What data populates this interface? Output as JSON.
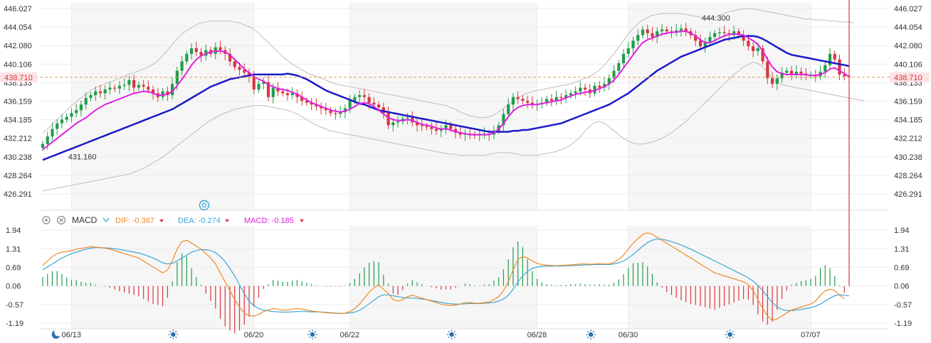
{
  "colors": {
    "up": "#1f9e4a",
    "down": "#d9363e",
    "ma_slow": "#1a1ac8",
    "ma_fast": "#e020e0",
    "band": "#c8b8bc",
    "current_line": "#e0a060",
    "current_tag_bg": "#fbe3e5",
    "current_tag_text": "#d9363e",
    "dif": "#f08a24",
    "dea": "#3aa6d8",
    "macd": "#e020e0",
    "grid": "#ececec"
  },
  "macd_toolbar": {
    "label": "MACD",
    "dif_label": "DIF: -0.367",
    "dea_label": "DEA: -0.274",
    "macd_label": "MACD: -0.185"
  },
  "chart_data": [
    {
      "type": "candlestick",
      "y_ticks": [
        "446.027",
        "444.054",
        "442.080",
        "440.106",
        "438.133",
        "436.159",
        "434.185",
        "432.212",
        "430.238",
        "428.264",
        "426.291"
      ],
      "ylim": [
        426.291,
        446.027
      ],
      "current_price": "438.710",
      "annotations": [
        {
          "text": "444.300",
          "x_index": 137,
          "value": 444.3
        },
        {
          "text": "431.160",
          "x_index": 5,
          "value": 431.16
        }
      ],
      "x_ticks": [
        {
          "label": "06/13",
          "index": 6
        },
        {
          "label": "06/20",
          "index": 44
        },
        {
          "label": "06/22",
          "index": 64
        },
        {
          "label": "06/28",
          "index": 103
        },
        {
          "label": "06/30",
          "index": 122
        },
        {
          "label": "07/07",
          "index": 160
        }
      ],
      "night_markers": [
        1
      ],
      "day_markers": [
        26,
        55,
        84,
        113,
        142
      ],
      "closes": [
        431.6,
        432.4,
        433.2,
        433.8,
        434.2,
        434.5,
        434.9,
        435.2,
        435.8,
        436.5,
        436.8,
        437.2,
        437.0,
        437.4,
        437.6,
        437.5,
        437.8,
        437.9,
        438.4,
        437.6,
        437.9,
        437.7,
        437.4,
        437.0,
        436.6,
        437.2,
        436.8,
        438.0,
        439.4,
        440.4,
        441.2,
        441.8,
        441.4,
        441.0,
        441.6,
        441.2,
        441.9,
        441.6,
        441.2,
        440.4,
        439.8,
        439.5,
        439.2,
        438.8,
        437.4,
        438.0,
        438.2,
        436.6,
        437.6,
        437.2,
        437.0,
        436.8,
        437.0,
        436.6,
        436.2,
        436.0,
        435.8,
        435.6,
        435.4,
        435.2,
        434.9,
        434.8,
        435.0,
        435.4,
        436.2,
        436.6,
        436.8,
        436.6,
        436.0,
        435.8,
        435.5,
        434.9,
        433.6,
        433.9,
        434.0,
        434.3,
        434.4,
        433.9,
        433.6,
        433.5,
        433.4,
        433.2,
        433.0,
        433.2,
        433.6,
        433.2,
        432.8,
        432.6,
        432.7,
        432.6,
        432.5,
        432.6,
        432.7,
        432.6,
        433.0,
        433.6,
        434.8,
        435.8,
        436.6,
        436.4,
        436.2,
        436.0,
        435.8,
        435.9,
        436.0,
        436.4,
        436.2,
        436.6,
        436.5,
        436.8,
        437.0,
        437.2,
        437.6,
        437.4,
        437.0,
        437.8,
        437.6,
        438.0,
        438.6,
        439.4,
        440.2,
        441.2,
        441.8,
        442.6,
        443.2,
        443.8,
        443.4,
        443.0,
        443.6,
        443.8,
        443.6,
        443.5,
        443.7,
        443.9,
        443.6,
        443.2,
        442.6,
        442.0,
        442.5,
        443.0,
        443.4,
        443.5,
        443.4,
        443.2,
        443.6,
        443.2,
        442.6,
        442.0,
        441.5,
        441.8,
        440.4,
        438.6,
        438.0,
        438.6,
        439.2,
        439.4,
        439.0,
        439.3,
        439.1,
        438.9,
        439.0,
        438.8,
        439.3,
        440.0,
        441.2,
        440.6,
        439.0,
        438.8,
        438.7
      ],
      "ma_fast": [
        431.0,
        431.4,
        431.8,
        432.2,
        432.6,
        433.0,
        433.4,
        433.8,
        434.1,
        434.4,
        434.8,
        435.2,
        435.5,
        435.8,
        436.0,
        436.2,
        436.4,
        436.6,
        436.8,
        437.0,
        437.1,
        437.2,
        437.2,
        437.0,
        436.8,
        436.8,
        436.9,
        437.2,
        437.8,
        438.5,
        439.2,
        440.0,
        440.6,
        441.0,
        441.2,
        441.4,
        441.5,
        441.5,
        441.4,
        441.1,
        440.6,
        440.1,
        439.6,
        439.2,
        438.8,
        438.5,
        438.3,
        437.9,
        437.7,
        437.5,
        437.4,
        437.3,
        437.1,
        436.9,
        436.6,
        436.3,
        436.0,
        435.8,
        435.6,
        435.4,
        435.2,
        435.1,
        435.0,
        435.1,
        435.3,
        435.6,
        435.9,
        436.0,
        435.9,
        435.6,
        435.2,
        434.8,
        434.4,
        434.2,
        434.1,
        434.1,
        434.2,
        434.1,
        433.9,
        433.7,
        433.6,
        433.5,
        433.3,
        433.2,
        433.2,
        433.1,
        432.9,
        432.8,
        432.7,
        432.6,
        432.6,
        432.6,
        432.6,
        432.6,
        432.8,
        433.2,
        433.8,
        434.5,
        435.1,
        435.5,
        435.7,
        435.8,
        435.8,
        435.8,
        435.9,
        436.0,
        436.1,
        436.2,
        436.3,
        436.5,
        436.7,
        436.9,
        437.0,
        437.1,
        437.2,
        437.3,
        437.5,
        437.7,
        438.0,
        438.4,
        439.0,
        439.7,
        440.4,
        441.1,
        441.8,
        442.4,
        442.7,
        442.9,
        443.1,
        443.3,
        443.4,
        443.5,
        443.5,
        443.6,
        443.6,
        443.4,
        443.1,
        442.7,
        442.4,
        442.4,
        442.6,
        442.9,
        443.1,
        443.3,
        443.3,
        443.3,
        443.2,
        442.9,
        442.6,
        442.2,
        441.5,
        440.6,
        439.8,
        439.3,
        439.1,
        439.0,
        439.0,
        439.0,
        439.0,
        439.0,
        438.9,
        438.9,
        439.0,
        439.2,
        439.6,
        439.7,
        439.4,
        439.1,
        438.8
      ],
      "ma_slow": [
        429.9,
        430.1,
        430.3,
        430.5,
        430.7,
        430.9,
        431.1,
        431.3,
        431.5,
        431.7,
        431.9,
        432.1,
        432.3,
        432.5,
        432.7,
        432.9,
        433.1,
        433.3,
        433.5,
        433.7,
        433.9,
        434.1,
        434.3,
        434.5,
        434.7,
        434.9,
        435.1,
        435.3,
        435.6,
        435.9,
        436.2,
        436.5,
        436.8,
        437.1,
        437.4,
        437.7,
        437.9,
        438.1,
        438.3,
        438.5,
        438.6,
        438.7,
        438.8,
        438.9,
        439.0,
        439.0,
        439.0,
        439.0,
        439.0,
        439.0,
        439.0,
        439.1,
        439.0,
        438.9,
        438.7,
        438.5,
        438.2,
        437.9,
        437.6,
        437.3,
        437.1,
        436.9,
        436.7,
        436.5,
        436.3,
        436.1,
        435.9,
        435.8,
        435.6,
        435.4,
        435.2,
        435.1,
        435.0,
        434.9,
        434.8,
        434.7,
        434.6,
        434.5,
        434.4,
        434.3,
        434.2,
        434.1,
        434.0,
        433.9,
        433.8,
        433.7,
        433.6,
        433.5,
        433.4,
        433.3,
        433.2,
        433.1,
        433.0,
        432.9,
        432.9,
        432.9,
        432.9,
        432.9,
        433.0,
        433.0,
        433.1,
        433.1,
        433.2,
        433.3,
        433.4,
        433.5,
        433.6,
        433.7,
        433.8,
        434.0,
        434.2,
        434.4,
        434.6,
        434.8,
        435.0,
        435.2,
        435.4,
        435.6,
        435.8,
        436.1,
        436.4,
        436.7,
        437.0,
        437.4,
        437.8,
        438.2,
        438.6,
        439.0,
        439.4,
        439.7,
        440.0,
        440.3,
        440.6,
        440.9,
        441.1,
        441.3,
        441.5,
        441.7,
        441.9,
        442.1,
        442.3,
        442.5,
        442.7,
        442.8,
        442.9,
        443.0,
        443.1,
        443.1,
        443.1,
        443.0,
        442.8,
        442.5,
        442.2,
        441.9,
        441.6,
        441.3,
        441.1,
        441.0,
        440.9,
        440.8,
        440.7,
        440.6,
        440.5,
        440.4,
        440.3,
        440.2,
        440.1,
        440.0,
        439.9
      ],
      "band_upper": [
        432.8,
        433.2,
        433.7,
        434.2,
        434.7,
        435.2,
        435.7,
        436.1,
        436.5,
        436.9,
        437.3,
        437.6,
        437.8,
        438.0,
        438.2,
        438.4,
        438.6,
        438.8,
        439.0,
        439.2,
        439.4,
        439.6,
        439.8,
        440.1,
        440.5,
        441.0,
        441.6,
        442.2,
        442.8,
        443.3,
        443.7,
        444.0,
        444.3,
        444.5,
        444.6,
        444.7,
        444.7,
        444.7,
        444.7,
        444.7,
        444.6,
        444.5,
        444.3,
        444.1,
        443.8,
        443.4,
        442.9,
        442.4,
        441.9,
        441.4,
        440.9,
        440.5,
        440.1,
        439.8,
        439.5,
        439.2,
        439.0,
        438.8,
        438.6,
        438.4,
        438.2,
        438.0,
        437.9,
        437.8,
        437.7,
        437.6,
        437.5,
        437.4,
        437.3,
        437.2,
        437.1,
        437.0,
        436.9,
        436.8,
        436.7,
        436.6,
        436.5,
        436.4,
        436.3,
        436.2,
        436.1,
        436.0,
        435.9,
        435.8,
        435.7,
        435.5,
        435.3,
        435.0,
        434.8,
        434.6,
        434.5,
        434.4,
        434.4,
        434.5,
        434.7,
        435.0,
        435.4,
        435.8,
        436.2,
        436.5,
        436.8,
        437.0,
        437.2,
        437.3,
        437.4,
        437.5,
        437.6,
        437.7,
        437.8,
        437.9,
        438.0,
        438.2,
        438.4,
        438.6,
        438.8,
        439.1,
        439.5,
        440.0,
        440.6,
        441.2,
        441.9,
        442.6,
        443.3,
        443.9,
        444.4,
        444.8,
        445.1,
        445.3,
        445.4,
        445.5,
        445.5,
        445.5,
        445.5,
        445.5,
        445.4,
        445.3,
        445.2,
        445.1,
        445.0,
        445.0,
        445.1,
        445.3,
        445.5,
        445.7,
        445.8,
        445.9,
        446.0,
        446.0,
        446.0,
        445.9,
        445.8,
        445.7,
        445.6,
        445.5,
        445.4,
        445.3,
        445.2,
        445.1,
        445.0,
        444.9,
        444.9,
        444.8,
        444.8,
        444.8,
        444.7,
        444.7,
        444.6,
        444.6,
        444.6,
        444.5
      ],
      "band_lower": [
        426.6,
        426.7,
        426.8,
        426.9,
        427.0,
        427.1,
        427.2,
        427.3,
        427.4,
        427.5,
        427.6,
        427.7,
        427.8,
        427.9,
        428.0,
        428.1,
        428.2,
        428.3,
        428.4,
        428.6,
        428.8,
        429.0,
        429.3,
        429.6,
        429.9,
        430.2,
        430.6,
        431.0,
        431.4,
        431.8,
        432.2,
        432.6,
        433.0,
        433.4,
        433.8,
        434.1,
        434.4,
        434.7,
        434.9,
        435.1,
        435.3,
        435.4,
        435.5,
        435.6,
        435.7,
        435.7,
        435.7,
        435.6,
        435.5,
        435.4,
        435.3,
        435.2,
        435.0,
        434.8,
        434.5,
        434.2,
        433.9,
        433.6,
        433.4,
        433.2,
        433.0,
        432.9,
        432.8,
        432.7,
        432.6,
        432.5,
        432.4,
        432.3,
        432.2,
        432.1,
        432.0,
        431.9,
        431.8,
        431.7,
        431.6,
        431.5,
        431.4,
        431.3,
        431.2,
        431.1,
        431.0,
        430.9,
        430.8,
        430.7,
        430.6,
        430.5,
        430.5,
        430.4,
        430.4,
        430.4,
        430.4,
        430.4,
        430.4,
        430.5,
        430.6,
        430.7,
        430.7,
        430.7,
        430.6,
        430.5,
        430.4,
        430.4,
        430.4,
        430.4,
        430.5,
        430.6,
        430.7,
        430.8,
        431.0,
        431.2,
        431.5,
        431.9,
        432.4,
        433.0,
        433.5,
        433.9,
        434.0,
        433.8,
        433.4,
        433.0,
        432.6,
        432.2,
        431.9,
        431.7,
        431.6,
        431.6,
        431.7,
        431.8,
        432.0,
        432.2,
        432.5,
        432.8,
        433.2,
        433.6,
        434.0,
        434.5,
        435.0,
        435.5,
        436.0,
        436.5,
        437.0,
        437.5,
        438.0,
        438.5,
        439.0,
        439.4,
        439.8,
        440.1,
        440.3,
        440.2,
        439.8,
        439.2,
        438.6,
        438.2,
        437.9,
        437.8,
        437.7,
        437.6,
        437.5,
        437.4,
        437.3,
        437.2,
        437.1,
        437.0,
        436.9,
        436.8,
        436.7,
        436.6,
        436.5,
        436.4,
        436.3,
        436.2
      ]
    },
    {
      "type": "macd",
      "y_ticks": [
        "1.94",
        "1.31",
        "0.69",
        "0.06",
        "-0.57",
        "-1.19"
      ],
      "ylim": [
        -1.19,
        1.94
      ],
      "dif": [
        0.75,
        0.9,
        1.05,
        1.15,
        1.2,
        1.22,
        1.25,
        1.3,
        1.32,
        1.35,
        1.38,
        1.37,
        1.35,
        1.33,
        1.3,
        1.25,
        1.2,
        1.15,
        1.1,
        1.05,
        1.0,
        0.9,
        0.8,
        0.7,
        0.6,
        0.5,
        0.6,
        0.9,
        1.3,
        1.55,
        1.6,
        1.5,
        1.4,
        1.3,
        1.15,
        1.0,
        0.8,
        0.5,
        0.2,
        -0.1,
        -0.4,
        -0.65,
        -0.85,
        -0.95,
        -0.95,
        -0.9,
        -0.8,
        -0.75,
        -0.7,
        -0.72,
        -0.75,
        -0.75,
        -0.72,
        -0.7,
        -0.72,
        -0.75,
        -0.78,
        -0.8,
        -0.82,
        -0.84,
        -0.85,
        -0.86,
        -0.87,
        -0.85,
        -0.8,
        -0.7,
        -0.55,
        -0.35,
        -0.15,
        0.0,
        0.1,
        -0.05,
        -0.2,
        -0.4,
        -0.45,
        -0.4,
        -0.3,
        -0.25,
        -0.3,
        -0.35,
        -0.4,
        -0.45,
        -0.5,
        -0.55,
        -0.58,
        -0.6,
        -0.58,
        -0.55,
        -0.5,
        -0.5,
        -0.52,
        -0.52,
        -0.5,
        -0.48,
        -0.4,
        -0.3,
        -0.1,
        0.2,
        0.6,
        0.95,
        1.05,
        1.0,
        0.9,
        0.82,
        0.78,
        0.76,
        0.75,
        0.74,
        0.75,
        0.76,
        0.77,
        0.78,
        0.8,
        0.8,
        0.79,
        0.8,
        0.81,
        0.8,
        0.8,
        0.85,
        0.95,
        1.1,
        1.3,
        1.5,
        1.65,
        1.8,
        1.85,
        1.8,
        1.7,
        1.6,
        1.5,
        1.4,
        1.3,
        1.2,
        1.1,
        1.0,
        0.9,
        0.8,
        0.7,
        0.6,
        0.5,
        0.45,
        0.4,
        0.35,
        0.3,
        0.25,
        0.2,
        0.1,
        -0.1,
        -0.4,
        -0.7,
        -0.95,
        -1.1,
        -1.05,
        -0.95,
        -0.85,
        -0.75,
        -0.7,
        -0.65,
        -0.6,
        -0.55,
        -0.45,
        -0.25,
        -0.1,
        -0.05,
        -0.1,
        -0.25,
        -0.367
      ],
      "dea": [
        0.6,
        0.7,
        0.8,
        0.9,
        1.0,
        1.08,
        1.15,
        1.2,
        1.25,
        1.3,
        1.33,
        1.35,
        1.35,
        1.34,
        1.33,
        1.31,
        1.29,
        1.26,
        1.23,
        1.2,
        1.17,
        1.12,
        1.06,
        1.0,
        0.92,
        0.84,
        0.8,
        0.82,
        0.9,
        1.0,
        1.1,
        1.2,
        1.25,
        1.28,
        1.28,
        1.25,
        1.18,
        1.05,
        0.88,
        0.65,
        0.4,
        0.1,
        -0.2,
        -0.45,
        -0.6,
        -0.7,
        -0.75,
        -0.78,
        -0.8,
        -0.81,
        -0.82,
        -0.82,
        -0.81,
        -0.8,
        -0.8,
        -0.8,
        -0.81,
        -0.81,
        -0.82,
        -0.83,
        -0.84,
        -0.85,
        -0.86,
        -0.86,
        -0.85,
        -0.82,
        -0.76,
        -0.66,
        -0.54,
        -0.42,
        -0.3,
        -0.24,
        -0.24,
        -0.27,
        -0.3,
        -0.33,
        -0.34,
        -0.35,
        -0.36,
        -0.38,
        -0.4,
        -0.43,
        -0.46,
        -0.49,
        -0.52,
        -0.54,
        -0.55,
        -0.55,
        -0.54,
        -0.53,
        -0.53,
        -0.53,
        -0.52,
        -0.51,
        -0.49,
        -0.45,
        -0.38,
        -0.25,
        -0.05,
        0.2,
        0.4,
        0.55,
        0.65,
        0.7,
        0.72,
        0.73,
        0.73,
        0.73,
        0.73,
        0.74,
        0.74,
        0.75,
        0.76,
        0.77,
        0.77,
        0.78,
        0.78,
        0.78,
        0.78,
        0.8,
        0.84,
        0.9,
        1.0,
        1.12,
        1.26,
        1.4,
        1.52,
        1.6,
        1.64,
        1.63,
        1.6,
        1.55,
        1.5,
        1.44,
        1.37,
        1.3,
        1.22,
        1.14,
        1.06,
        0.98,
        0.9,
        0.82,
        0.74,
        0.66,
        0.58,
        0.5,
        0.42,
        0.33,
        0.22,
        0.08,
        -0.1,
        -0.3,
        -0.5,
        -0.65,
        -0.73,
        -0.77,
        -0.77,
        -0.75,
        -0.73,
        -0.7,
        -0.67,
        -0.62,
        -0.55,
        -0.45,
        -0.35,
        -0.27,
        -0.24,
        -0.25,
        -0.274
      ]
    }
  ]
}
